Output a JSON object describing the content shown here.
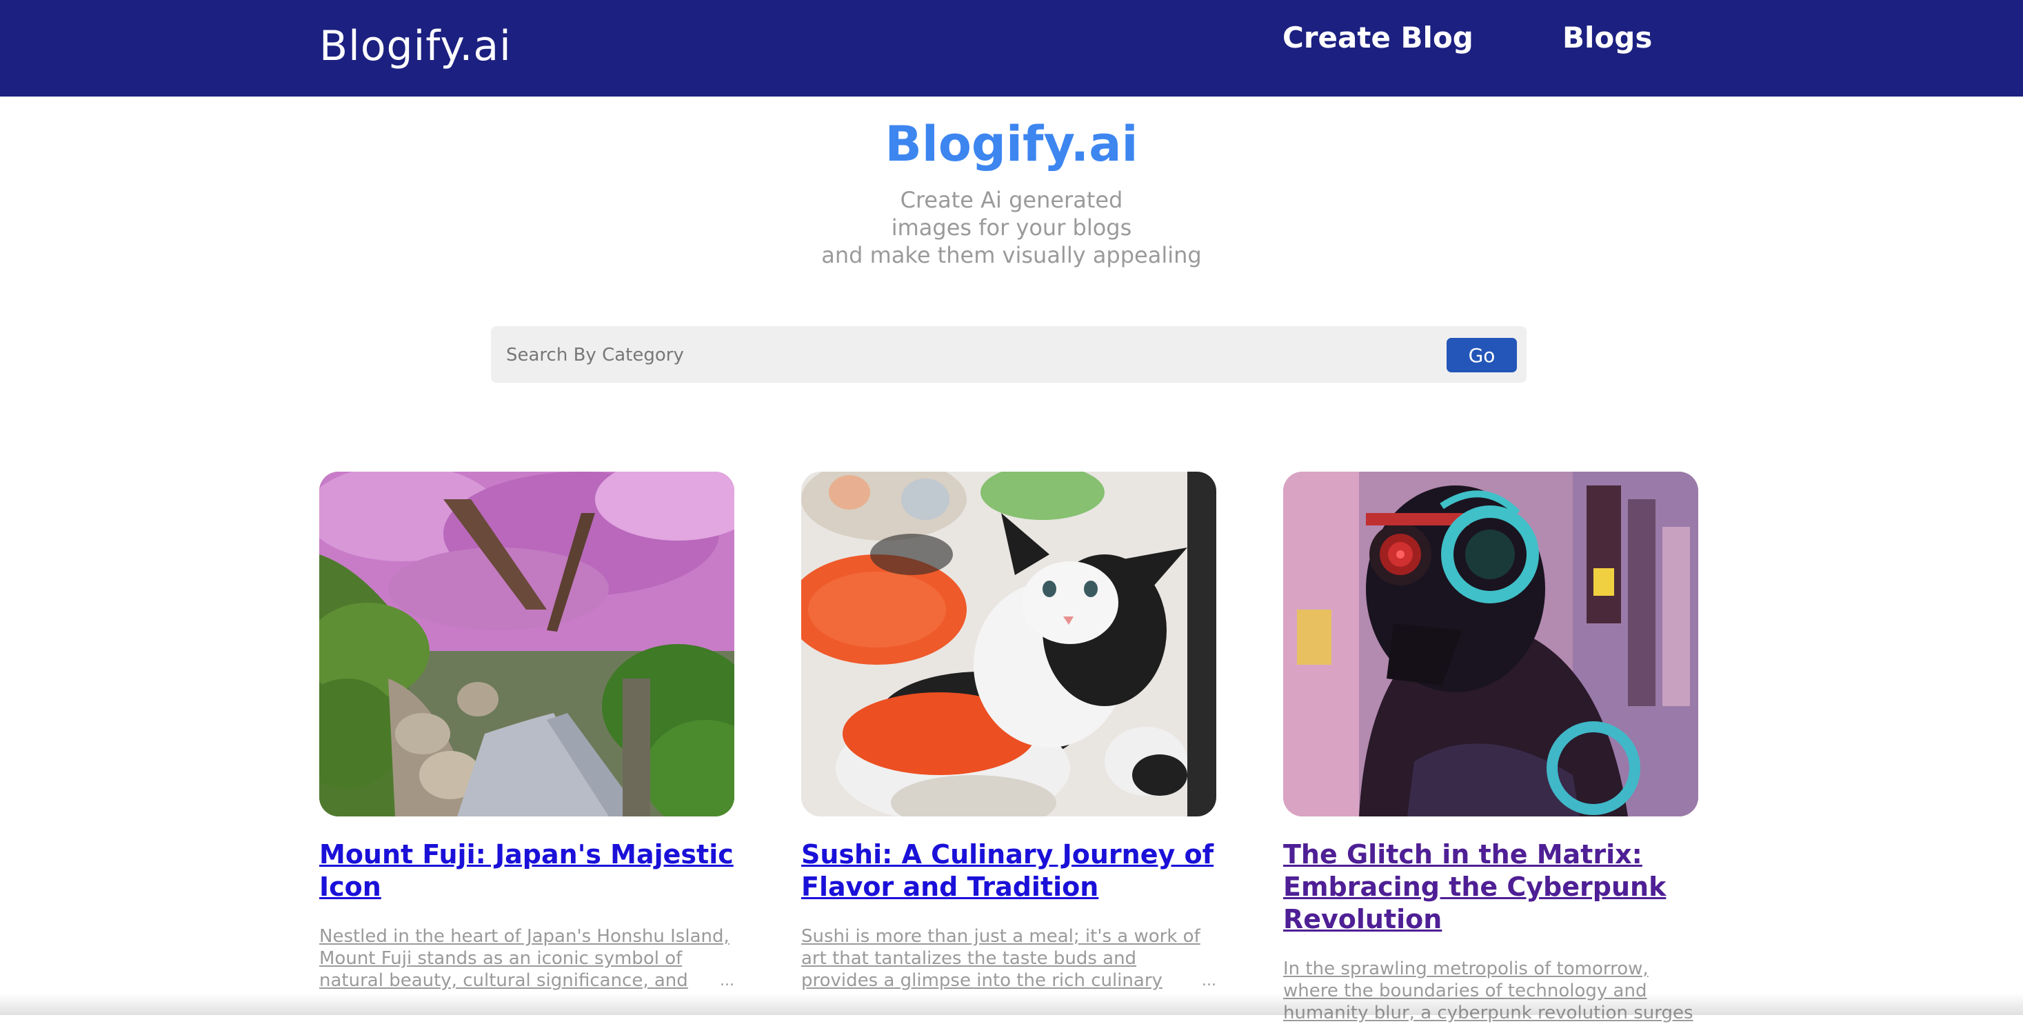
{
  "navbar": {
    "brand": "Blogify.ai",
    "links": [
      "Create Blog",
      "Blogs"
    ]
  },
  "hero": {
    "title": "Blogify.ai",
    "subtitle_lines": [
      "Create Ai generated",
      "images for your blogs",
      "and make them visually appealing"
    ]
  },
  "search": {
    "placeholder": "Search By Category",
    "button_label": "Go"
  },
  "cards": [
    {
      "image": "cherry-blossom-stone-path",
      "title": "Mount Fuji: Japan's Majestic Icon",
      "excerpt": "Nestled in the heart of Japan's Honshu Island, Mount Fuji stands as an iconic symbol of natural beauty, cultural significance, and",
      "ellipsis": "..."
    },
    {
      "image": "kitten-with-sushi",
      "title": "Sushi: A Culinary Journey of Flavor and Tradition",
      "excerpt": "Sushi is more than just a meal; it's a work of art that tantalizes the taste buds and provides a glimpse into the rich culinary",
      "ellipsis": "..."
    },
    {
      "image": "cyberpunk-figure-with-headphones",
      "title": "The Glitch in the Matrix: Embracing the Cyberpunk Revolution",
      "excerpt": "In the sprawling metropolis of tomorrow, where the boundaries of technology and humanity blur, a cyberpunk revolution surges",
      "ellipsis": ""
    }
  ],
  "colors": {
    "navbar": "#1c2080",
    "hero_title": "#3d86f0",
    "go_button": "#2356b8",
    "link_unvisited": "#1a10d8",
    "link_visited": "#4e1f95"
  }
}
